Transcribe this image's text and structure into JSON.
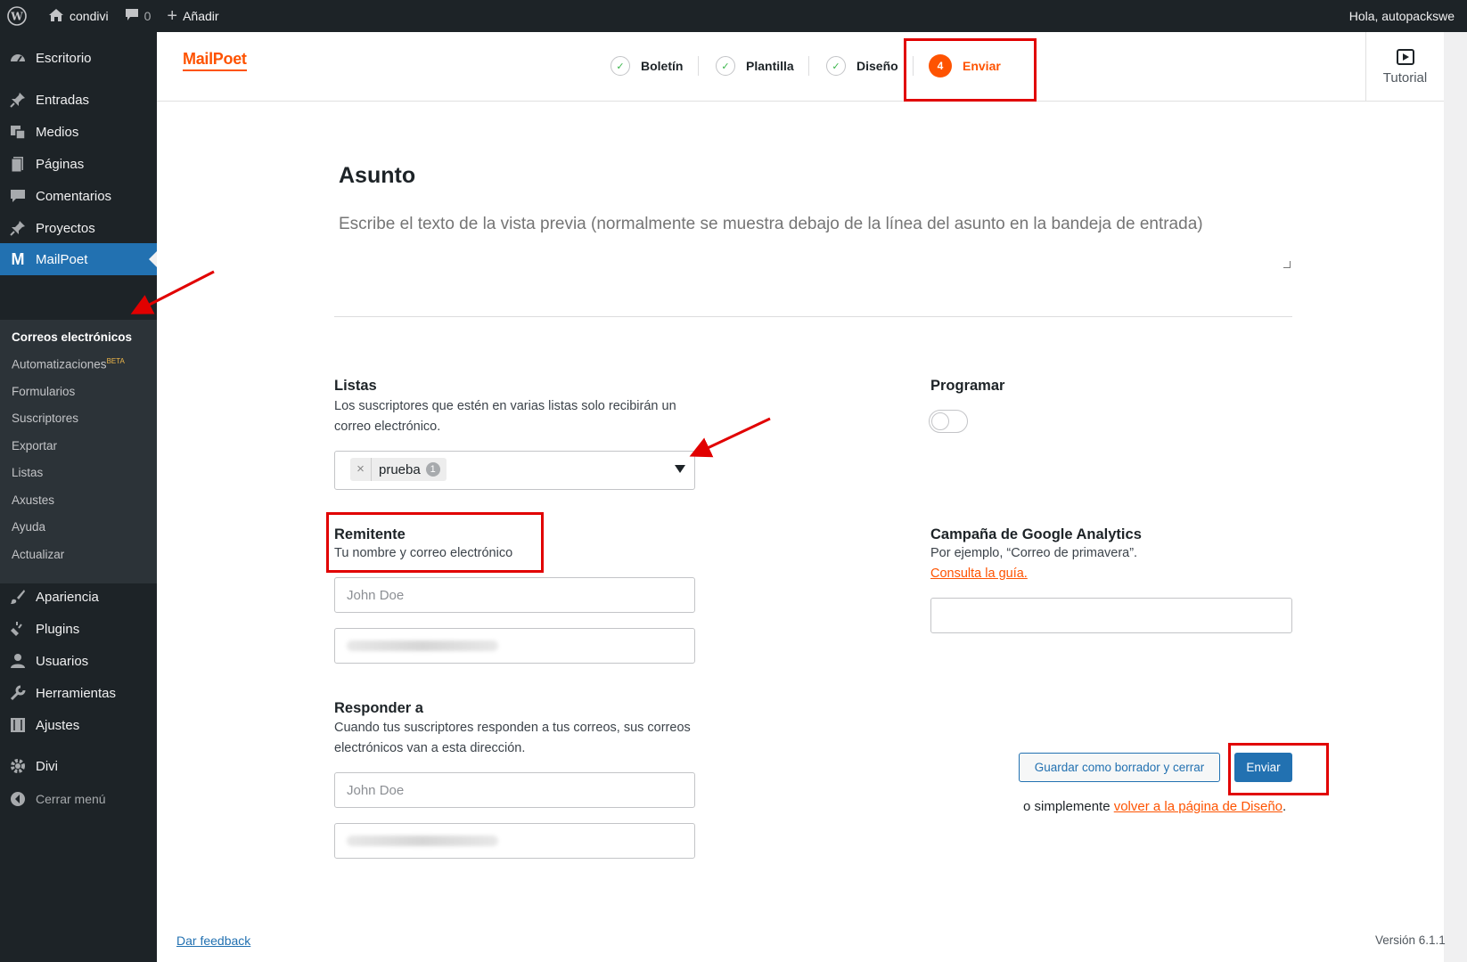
{
  "adminbar": {
    "site_name": "condivi",
    "comments_count": "0",
    "add_label": "Añadir",
    "greeting": "Hola, autopackswe"
  },
  "sidebar": {
    "items": [
      {
        "label": "Escritorio",
        "icon": "dashboard-icon"
      },
      {
        "label": "Entradas",
        "icon": "pin-icon"
      },
      {
        "label": "Medios",
        "icon": "media-icon"
      },
      {
        "label": "Páginas",
        "icon": "page-icon"
      },
      {
        "label": "Comentarios",
        "icon": "comment-icon"
      },
      {
        "label": "Proyectos",
        "icon": "pin-icon"
      },
      {
        "label": "MailPoet",
        "icon": "mailpoet-icon"
      }
    ],
    "submenu": [
      {
        "label": "Correos electrónicos"
      },
      {
        "label": "Automatizaciones",
        "badge": "BETA"
      },
      {
        "label": "Formularios"
      },
      {
        "label": "Suscriptores"
      },
      {
        "label": "Exportar"
      },
      {
        "label": "Listas"
      },
      {
        "label": "Axustes"
      },
      {
        "label": "Ayuda"
      },
      {
        "label": "Actualizar"
      }
    ],
    "items2": [
      {
        "label": "Apariencia",
        "icon": "brush-icon"
      },
      {
        "label": "Plugins",
        "icon": "plugin-icon"
      },
      {
        "label": "Usuarios",
        "icon": "user-icon"
      },
      {
        "label": "Herramientas",
        "icon": "wrench-icon"
      },
      {
        "label": "Ajustes",
        "icon": "settings-icon"
      },
      {
        "label": "Divi",
        "icon": "gear-icon"
      },
      {
        "label": "Cerrar menú",
        "icon": "collapse-icon"
      }
    ]
  },
  "header": {
    "logo": "MailPoet",
    "steps": [
      {
        "label": "Boletín",
        "state": "done"
      },
      {
        "label": "Plantilla",
        "state": "done"
      },
      {
        "label": "Diseño",
        "state": "done"
      },
      {
        "number": "4",
        "label": "Enviar",
        "state": "current"
      }
    ],
    "tutorial_label": "Tutorial"
  },
  "form": {
    "subject_placeholder": "Asunto",
    "preview_placeholder": "Escribe el texto de la vista previa (normalmente se muestra debajo de la línea del asunto en la bandeja de entrada)",
    "lists": {
      "label": "Listas",
      "description": "Los suscriptores que estén en varias listas solo recibirán un correo electrónico.",
      "selected": [
        {
          "name": "prueba",
          "count": "1",
          "remove": "×"
        }
      ]
    },
    "sender": {
      "label": "Remitente",
      "description": "Tu nombre y correo electrónico",
      "name_placeholder": "John Doe"
    },
    "reply_to": {
      "label": "Responder a",
      "description": "Cuando tus suscriptores responden a tus correos, sus correos electrónicos van a esta dirección.",
      "name_placeholder": "John Doe"
    },
    "schedule": {
      "label": "Programar",
      "enabled": false
    },
    "ga": {
      "label": "Campaña de Google Analytics",
      "description": "Por ejemplo, “Correo de primavera”.",
      "link": "Consulta la guía."
    },
    "actions": {
      "draft_label": "Guardar como borrador y cerrar",
      "send_label": "Enviar",
      "or_text": "o simplemente",
      "back_link": "volver a la página de Diseño",
      "back_suffix": "."
    }
  },
  "footer": {
    "feedback": "Dar feedback",
    "version": "Versión 6.1.1"
  },
  "colors": {
    "brand": "#fe5301",
    "wp_blue": "#2271b1",
    "annotation": "#e10000"
  }
}
